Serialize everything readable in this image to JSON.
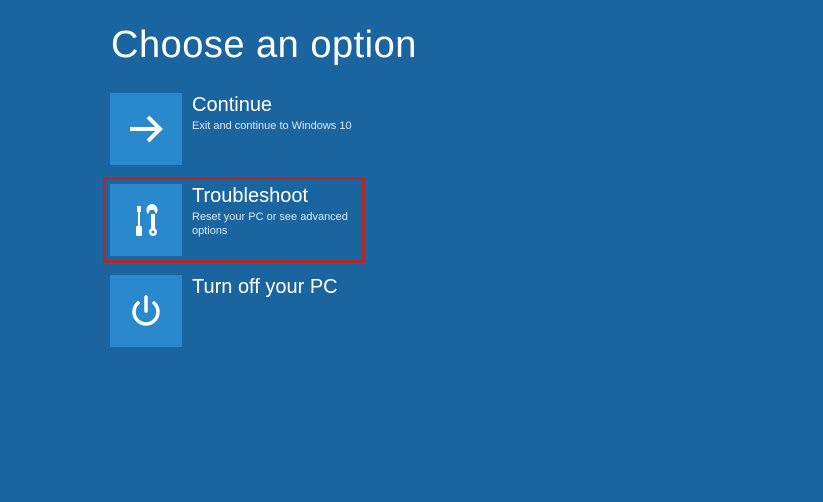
{
  "page": {
    "title": "Choose an option"
  },
  "options": {
    "continue": {
      "title": "Continue",
      "desc": "Exit and continue to Windows 10"
    },
    "troubleshoot": {
      "title": "Troubleshoot",
      "desc": "Reset your PC or see advanced options"
    },
    "turnoff": {
      "title": "Turn off your PC",
      "desc": ""
    }
  },
  "colors": {
    "background": "#1a64a0",
    "tile": "#2989cc",
    "highlight": "#b12a2a"
  }
}
